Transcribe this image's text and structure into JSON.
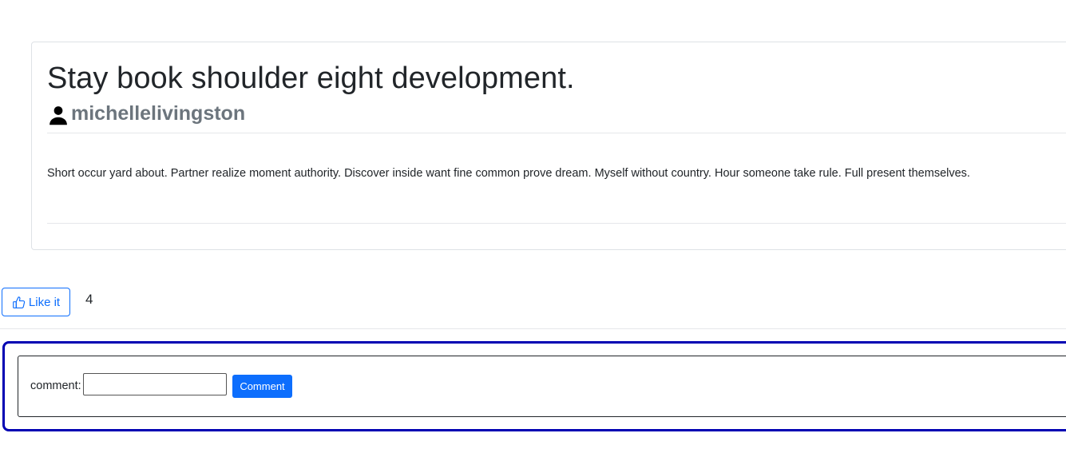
{
  "post": {
    "title": "Stay book shoulder eight development.",
    "author": "michellelivingston",
    "body": "Short occur yard about. Partner realize moment authority. Discover inside want fine common prove dream. Myself without country. Hour someone take rule. Full present themselves."
  },
  "like": {
    "button_label": "Like it",
    "count": "4"
  },
  "comment_form": {
    "label": "comment:",
    "input_value": "",
    "submit_label": "Comment"
  },
  "icons": {
    "author": "person-icon",
    "like": "thumbs-up-icon"
  },
  "colors": {
    "accent": "#0d6efd",
    "form_border": "#0000b3",
    "author_text": "#6c757d"
  }
}
